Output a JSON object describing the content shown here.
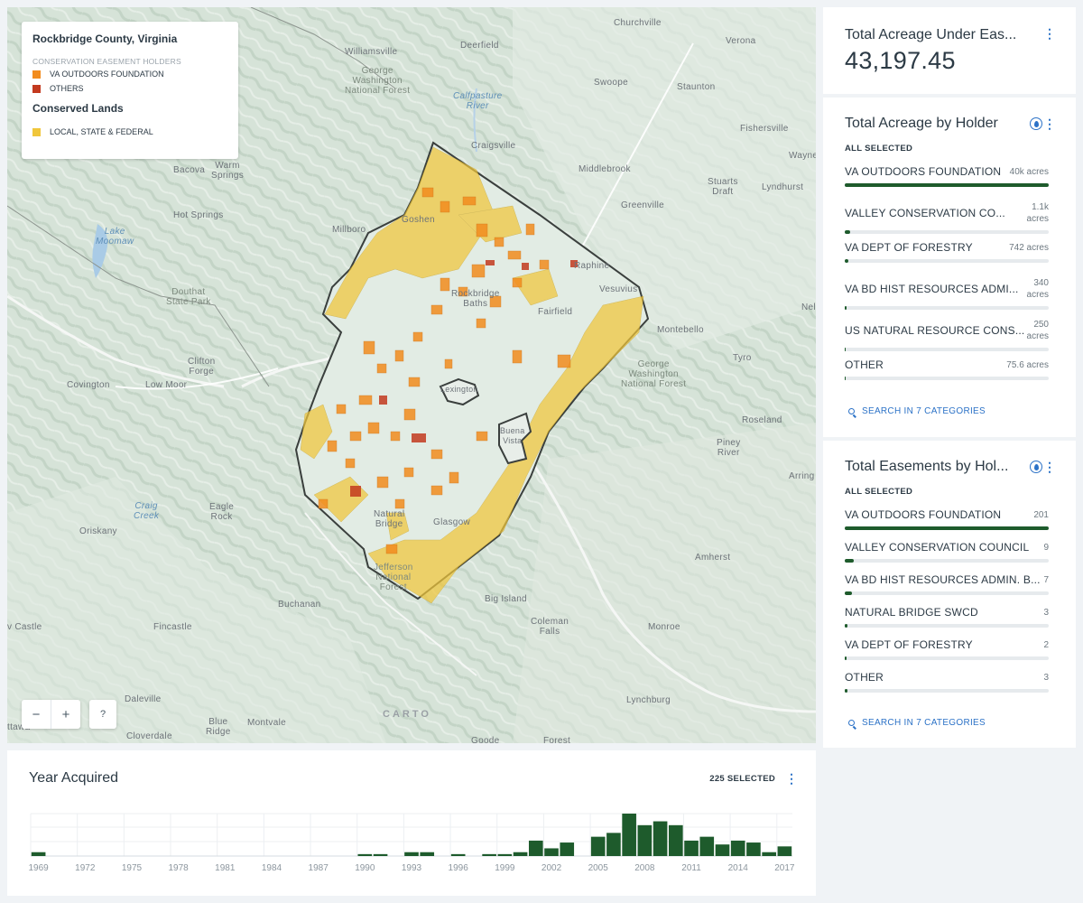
{
  "legend": {
    "title": "Rockbridge County, Virginia",
    "easement_heading": "CONSERVATION EASEMENT HOLDERS",
    "items": [
      {
        "label": "VA OUTDOORS FOUNDATION",
        "color": "#f28c1e"
      },
      {
        "label": "OTHERS",
        "color": "#c33a1f"
      }
    ],
    "conserved_heading": "Conserved Lands",
    "conserved_items": [
      {
        "label": "LOCAL, STATE & FEDERAL",
        "color": "#f0c63b"
      }
    ]
  },
  "map_labels": [
    {
      "text": "Churchville",
      "cls": ""
    },
    {
      "text": "Verona",
      "cls": ""
    },
    {
      "text": "Williamsville",
      "cls": ""
    },
    {
      "text": "Deerfield",
      "cls": ""
    },
    {
      "text": "George\nWashington\nNational Forest",
      "cls": "forest"
    },
    {
      "text": "Calfpasture\nRiver",
      "cls": "water"
    },
    {
      "text": "Swoope",
      "cls": ""
    },
    {
      "text": "Staunton",
      "cls": ""
    },
    {
      "text": "Craigsville",
      "cls": ""
    },
    {
      "text": "Fishersville",
      "cls": ""
    },
    {
      "text": "Bacova",
      "cls": ""
    },
    {
      "text": "Warm\nSprings",
      "cls": ""
    },
    {
      "text": "Middlebrook",
      "cls": ""
    },
    {
      "text": "Stuarts\nDraft",
      "cls": ""
    },
    {
      "text": "Lyndhurst",
      "cls": ""
    },
    {
      "text": "Wayne",
      "cls": ""
    },
    {
      "text": "Hot Springs",
      "cls": ""
    },
    {
      "text": "Greenville",
      "cls": ""
    },
    {
      "text": "Goshen",
      "cls": ""
    },
    {
      "text": "Millboro",
      "cls": ""
    },
    {
      "text": "Lake\nMoomaw",
      "cls": "water"
    },
    {
      "text": "Raphine",
      "cls": ""
    },
    {
      "text": "Douthat\nState Park",
      "cls": "forest"
    },
    {
      "text": "Rockbridge\nBaths",
      "cls": ""
    },
    {
      "text": "Vesuvius",
      "cls": ""
    },
    {
      "text": "Nel",
      "cls": ""
    },
    {
      "text": "Fairfield",
      "cls": ""
    },
    {
      "text": "Montebello",
      "cls": ""
    },
    {
      "text": "Clifton\nForge",
      "cls": ""
    },
    {
      "text": "Tyro",
      "cls": ""
    },
    {
      "text": "George\nWashington\nNational Forest",
      "cls": "forest"
    },
    {
      "text": "Covington",
      "cls": ""
    },
    {
      "text": "Low Moor",
      "cls": ""
    },
    {
      "text": "Lexington",
      "cls": ""
    },
    {
      "text": "Roseland",
      "cls": ""
    },
    {
      "text": "Buena\nVista",
      "cls": ""
    },
    {
      "text": "Piney\nRiver",
      "cls": ""
    },
    {
      "text": "Arring",
      "cls": ""
    },
    {
      "text": "Craig\nCreek",
      "cls": "water"
    },
    {
      "text": "Eagle\nRock",
      "cls": ""
    },
    {
      "text": "Oriskany",
      "cls": ""
    },
    {
      "text": "Natural\nBridge",
      "cls": ""
    },
    {
      "text": "Glasgow",
      "cls": ""
    },
    {
      "text": "Amherst",
      "cls": ""
    },
    {
      "text": "Jefferson\nNational\nForest",
      "cls": "forest"
    },
    {
      "text": "Buchanan",
      "cls": ""
    },
    {
      "text": "Big Island",
      "cls": ""
    },
    {
      "text": "Fincastle",
      "cls": ""
    },
    {
      "text": "Coleman\nFalls",
      "cls": ""
    },
    {
      "text": "Monroe",
      "cls": ""
    },
    {
      "text": "v Castle",
      "cls": ""
    },
    {
      "text": "Daleville",
      "cls": ""
    },
    {
      "text": "Lynchburg",
      "cls": ""
    },
    {
      "text": "Blue\nRidge",
      "cls": ""
    },
    {
      "text": "Montvale",
      "cls": ""
    },
    {
      "text": "Cloverdale",
      "cls": ""
    },
    {
      "text": "Goode",
      "cls": ""
    },
    {
      "text": "Forest",
      "cls": ""
    },
    {
      "text": "ttawa",
      "cls": ""
    }
  ],
  "zoom": {
    "out": "−",
    "in": "+",
    "help": "?"
  },
  "attribution": "CARTO",
  "total_acreage": {
    "title": "Total Acreage Under Eas...",
    "value": "43,197.45"
  },
  "acreage_by_holder": {
    "title": "Total Acreage by Holder",
    "all_selected": "ALL SELECTED",
    "items": [
      {
        "name": "VA OUTDOORS FOUNDATION",
        "value": "40k acres",
        "fraction": 1.0
      },
      {
        "name": "VALLEY CONSERVATION CO...",
        "value": "1.1k\nacres",
        "fraction": 0.027
      },
      {
        "name": "VA DEPT OF FORESTRY",
        "value": "742 acres",
        "fraction": 0.018
      },
      {
        "name": "VA BD HIST RESOURCES ADMI...",
        "value": "340\nacres",
        "fraction": 0.008
      },
      {
        "name": "US NATURAL RESOURCE CONS...",
        "value": "250\nacres",
        "fraction": 0.006
      },
      {
        "name": "OTHER",
        "value": "75.6 acres",
        "fraction": 0.002
      }
    ],
    "search": "SEARCH IN 7 CATEGORIES"
  },
  "easements_by_holder": {
    "title": "Total Easements by Hol...",
    "all_selected": "ALL SELECTED",
    "items": [
      {
        "name": "VA OUTDOORS FOUNDATION",
        "value": "201",
        "fraction": 1.0
      },
      {
        "name": "VALLEY CONSERVATION COUNCIL",
        "value": "9",
        "fraction": 0.045
      },
      {
        "name": "VA BD HIST RESOURCES ADMIN. B...",
        "value": "7",
        "fraction": 0.035
      },
      {
        "name": "NATURAL BRIDGE SWCD",
        "value": "3",
        "fraction": 0.015
      },
      {
        "name": "VA DEPT OF FORESTRY",
        "value": "2",
        "fraction": 0.01
      },
      {
        "name": "OTHER",
        "value": "3",
        "fraction": 0.015
      }
    ],
    "search": "SEARCH IN 7 CATEGORIES"
  },
  "histogram": {
    "title": "Year Acquired",
    "selected": "225 SELECTED",
    "more_icon": "more-vertical-icon"
  },
  "chart_data": {
    "type": "bar",
    "title": "Year Acquired",
    "x": [
      1969,
      1970,
      1971,
      1972,
      1973,
      1974,
      1975,
      1976,
      1977,
      1978,
      1979,
      1980,
      1981,
      1982,
      1983,
      1984,
      1985,
      1986,
      1987,
      1988,
      1989,
      1990,
      1991,
      1992,
      1993,
      1994,
      1995,
      1996,
      1997,
      1998,
      1999,
      2000,
      2001,
      2002,
      2003,
      2004,
      2005,
      2006,
      2007,
      2008,
      2009,
      2010,
      2011,
      2012,
      2013,
      2014,
      2015,
      2016,
      2017
    ],
    "values": [
      1,
      0,
      0,
      0,
      0,
      0,
      0,
      0,
      0,
      0,
      0,
      0,
      0,
      0,
      0,
      0,
      0,
      0,
      0,
      0,
      0,
      0.5,
      0.5,
      0,
      1,
      1,
      0,
      0.5,
      0,
      0.5,
      0.5,
      1,
      4,
      2,
      3.5,
      0,
      5,
      6,
      11,
      8,
      9,
      8,
      4,
      5,
      3,
      4,
      3.5,
      1,
      2.5
    ],
    "xticks": [
      1969,
      1972,
      1975,
      1978,
      1981,
      1984,
      1987,
      1990,
      1993,
      1996,
      1999,
      2002,
      2005,
      2008,
      2011,
      2014,
      2017
    ],
    "color": "#1e5b2c",
    "grid": true
  }
}
